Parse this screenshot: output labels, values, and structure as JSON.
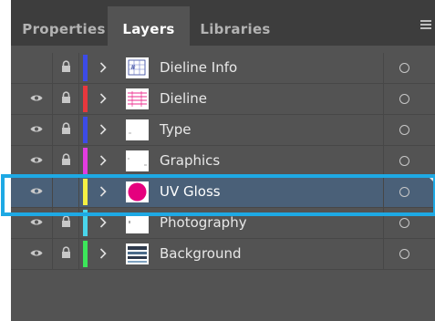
{
  "tabs": [
    {
      "label": "Properties",
      "active": false
    },
    {
      "label": "Layers",
      "active": true
    },
    {
      "label": "Libraries",
      "active": false
    }
  ],
  "menu_icon": "hamburger-menu-icon",
  "layers": [
    {
      "name": "Dieline Info",
      "visible": false,
      "locked": true,
      "color": "#3c4be8",
      "thumbnail": "dieline-info-thumbnail",
      "selected": false
    },
    {
      "name": "Dieline",
      "visible": true,
      "locked": true,
      "color": "#e8383d",
      "thumbnail": "dieline-thumbnail",
      "selected": false
    },
    {
      "name": "Type",
      "visible": true,
      "locked": true,
      "color": "#3c4be8",
      "thumbnail": "type-thumbnail",
      "selected": false
    },
    {
      "name": "Graphics",
      "visible": true,
      "locked": true,
      "color": "#e23ce0",
      "thumbnail": "graphics-thumbnail",
      "selected": false
    },
    {
      "name": "UV Gloss",
      "visible": true,
      "locked": false,
      "color": "#f4f043",
      "thumbnail": "uv-gloss-thumbnail",
      "selected": true
    },
    {
      "name": "Photography",
      "visible": true,
      "locked": true,
      "color": "#4ad6ec",
      "thumbnail": "photography-thumbnail",
      "selected": false
    },
    {
      "name": "Background",
      "visible": true,
      "locked": true,
      "color": "#3ce65a",
      "thumbnail": "background-thumbnail",
      "selected": false
    }
  ],
  "colors": {
    "panel_bg": "#535353",
    "tab_bar_bg": "#3d3d3d",
    "selected_row_bg": "#4a6078",
    "highlight_border": "#1ea9e4",
    "uv_gloss_swatch": "#e5007e"
  }
}
